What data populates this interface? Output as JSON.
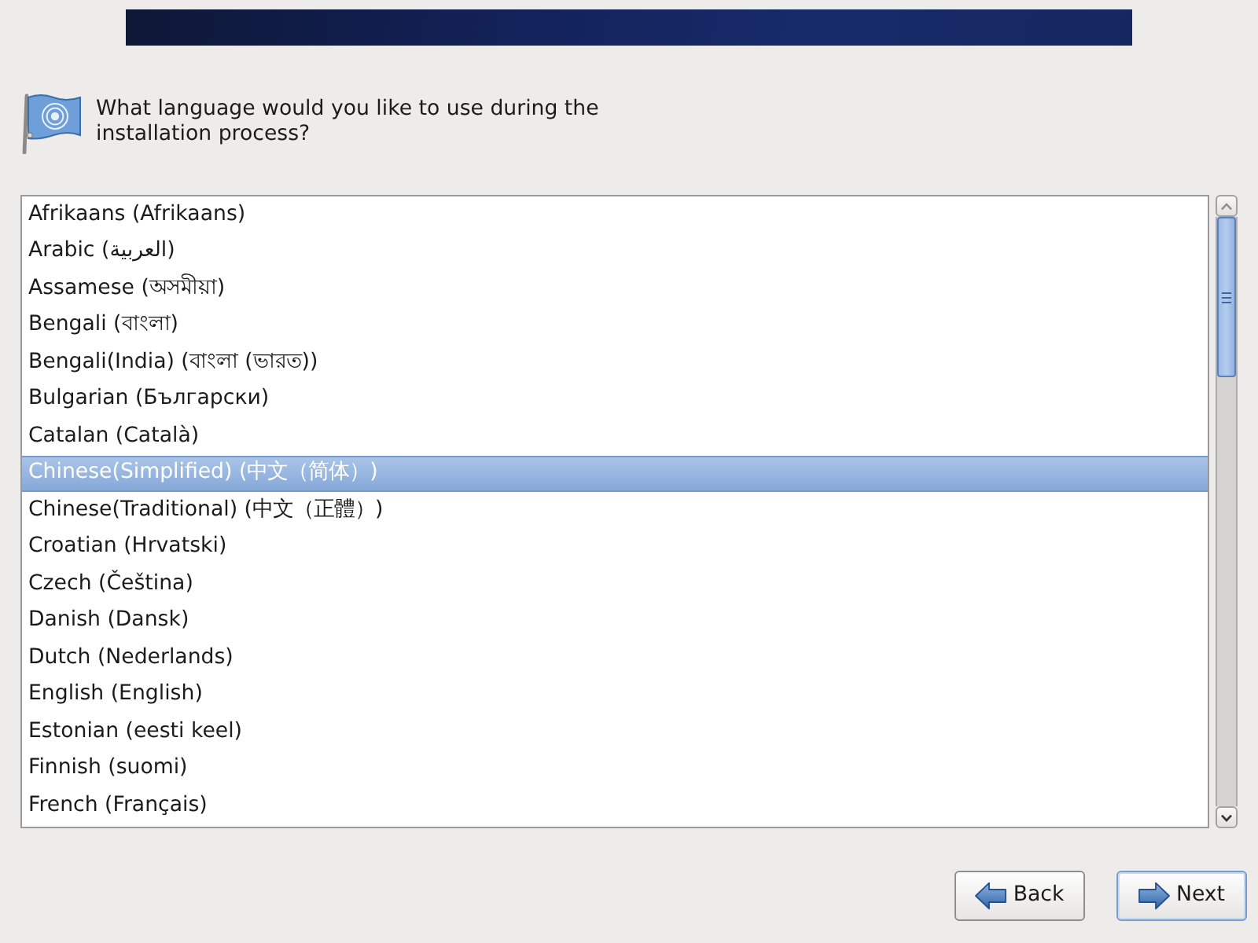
{
  "prompt": "What language would you like to use during the installation process?",
  "languages": [
    {
      "name": "Afrikaans (Afrikaans)",
      "selected": false
    },
    {
      "name": "Arabic (العربية)",
      "selected": false
    },
    {
      "name": "Assamese (অসমীয়া)",
      "selected": false
    },
    {
      "name": "Bengali (বাংলা)",
      "selected": false
    },
    {
      "name": "Bengali(India) (বাংলা (ভারত))",
      "selected": false
    },
    {
      "name": "Bulgarian (Български)",
      "selected": false
    },
    {
      "name": "Catalan (Català)",
      "selected": false
    },
    {
      "name": "Chinese(Simplified) (中文（简体）)",
      "selected": true
    },
    {
      "name": "Chinese(Traditional) (中文（正體）)",
      "selected": false
    },
    {
      "name": "Croatian (Hrvatski)",
      "selected": false
    },
    {
      "name": "Czech (Čeština)",
      "selected": false
    },
    {
      "name": "Danish (Dansk)",
      "selected": false
    },
    {
      "name": "Dutch (Nederlands)",
      "selected": false
    },
    {
      "name": "English (English)",
      "selected": false
    },
    {
      "name": "Estonian (eesti keel)",
      "selected": false
    },
    {
      "name": "Finnish (suomi)",
      "selected": false
    },
    {
      "name": "French (Français)",
      "selected": false
    }
  ],
  "buttons": [
    {
      "kind": "back",
      "label": "Back",
      "focused": false
    },
    {
      "kind": "next",
      "label": "Next",
      "focused": true
    }
  ]
}
